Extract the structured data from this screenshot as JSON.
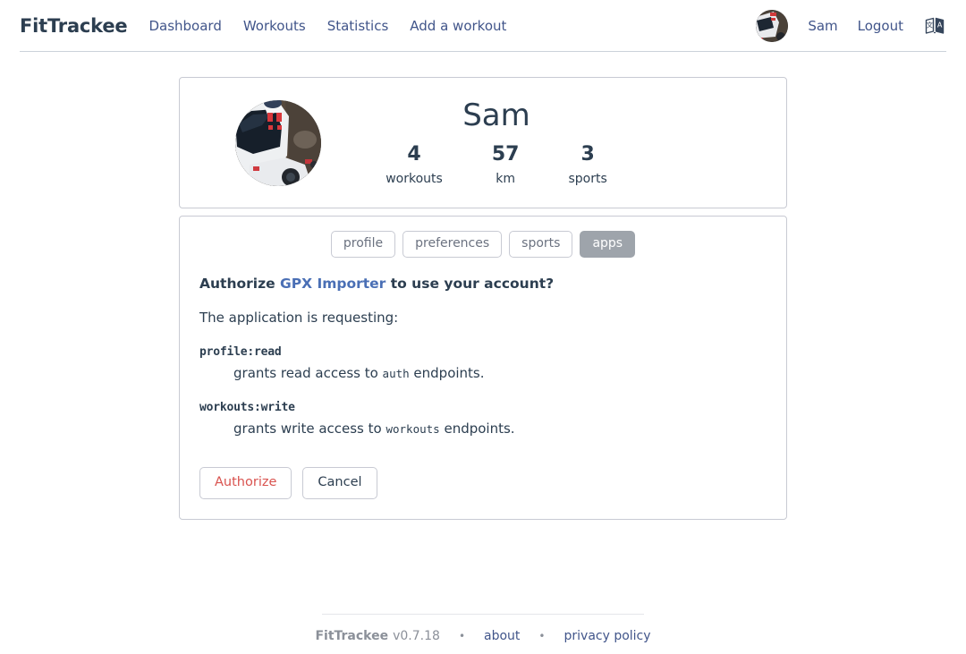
{
  "header": {
    "brand": "FitTrackee",
    "nav_links": [
      {
        "label": "Dashboard"
      },
      {
        "label": "Workouts"
      },
      {
        "label": "Statistics"
      },
      {
        "label": "Add a workout"
      }
    ],
    "avatar_icon": "user-avatar-photo",
    "user_label": "Sam",
    "logout_label": "Logout",
    "language_icon": "language-switch-icon"
  },
  "profile": {
    "avatar_icon": "profile-photo-helmet",
    "name": "Sam",
    "stats": [
      {
        "value": "4",
        "label": "workouts"
      },
      {
        "value": "57",
        "label": "km"
      },
      {
        "value": "3",
        "label": "sports"
      }
    ]
  },
  "tabs": [
    {
      "label": "profile",
      "active": false
    },
    {
      "label": "preferences",
      "active": false
    },
    {
      "label": "sports",
      "active": false
    },
    {
      "label": "apps",
      "active": true
    }
  ],
  "authorization": {
    "title_prefix": "Authorize ",
    "client_name": "GPX Importer",
    "title_suffix": " to use your account?",
    "requesting_label": "The application is requesting:",
    "scopes": [
      {
        "name": "profile:read",
        "desc_prefix": "grants read access to ",
        "desc_code": "auth",
        "desc_suffix": " endpoints."
      },
      {
        "name": "workouts:write",
        "desc_prefix": "grants write access to ",
        "desc_code": "workouts",
        "desc_suffix": " endpoints."
      }
    ],
    "authorize_label": "Authorize",
    "cancel_label": "Cancel"
  },
  "footer": {
    "brand": "FitTrackee",
    "version": "v0.7.18",
    "dot1": "•",
    "about_label": "about",
    "dot2": "•",
    "privacy_label": "privacy policy"
  },
  "colors": {
    "text_dark": "#2c3e50",
    "link_blue": "#41558a",
    "client_link": "#4a6fb5",
    "danger_red": "#d9534f",
    "tab_active_bg": "#9ea4ab",
    "border_gray": "#c8cad3",
    "muted_gray": "#8b9099"
  }
}
